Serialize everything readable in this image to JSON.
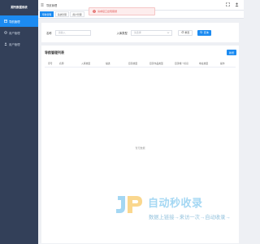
{
  "app": {
    "title": "期刊数据系统"
  },
  "sidebar": {
    "items": [
      {
        "label": "导航管理",
        "icon": "table-icon",
        "active": true
      },
      {
        "label": "用户管理",
        "icon": "gear-icon",
        "active": false
      },
      {
        "label": "用户管理",
        "icon": "user-icon",
        "active": false
      }
    ]
  },
  "header": {
    "breadcrumb": "导航管理"
  },
  "tabs": [
    {
      "label": "导航管理",
      "active": true
    },
    {
      "label": "系统管理",
      "active": false
    },
    {
      "label": "用户管理",
      "active": false
    }
  ],
  "toast": {
    "message": "请求接口出现错误",
    "type": "error"
  },
  "search": {
    "name_label": "名称",
    "name_placeholder": "请输入",
    "type_label": "入库类型",
    "type_placeholder": "请选择",
    "reset_label": "重置",
    "search_label": "查询"
  },
  "table": {
    "title": "导航管理列表",
    "add_label": "新增",
    "columns": [
      "序号",
      "名称",
      "入库类型",
      "描述",
      "目录类型",
      "目录作品类型",
      "目录唯一标识",
      "地址类型",
      "操作"
    ],
    "empty_text": "暂无数据"
  },
  "watermark": {
    "title": "自动秒收录",
    "subtitle": "数据上链接→来访一次→自动收录→"
  },
  "colors": {
    "accent": "#1c8bf1",
    "sidebar": "#334059",
    "error": "#e0504d"
  }
}
